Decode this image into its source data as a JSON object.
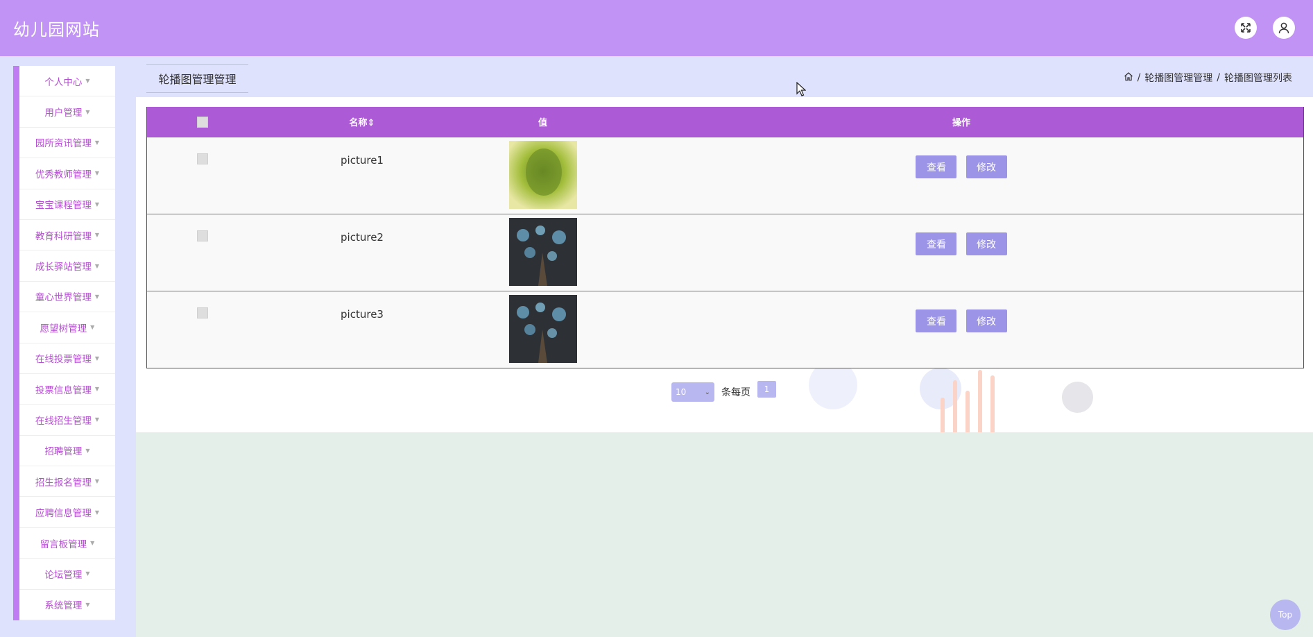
{
  "app": {
    "title": "幼儿园网站"
  },
  "sidebar": {
    "items": [
      {
        "label": "个人中心"
      },
      {
        "label": "用户管理"
      },
      {
        "label": "园所资讯管理"
      },
      {
        "label": "优秀教师管理"
      },
      {
        "label": "宝宝课程管理"
      },
      {
        "label": "教育科研管理"
      },
      {
        "label": "成长驿站管理"
      },
      {
        "label": "童心世界管理"
      },
      {
        "label": "愿望树管理"
      },
      {
        "label": "在线投票管理"
      },
      {
        "label": "投票信息管理"
      },
      {
        "label": "在线招生管理"
      },
      {
        "label": "招聘管理"
      },
      {
        "label": "招生报名管理"
      },
      {
        "label": "应聘信息管理"
      },
      {
        "label": "留言板管理"
      },
      {
        "label": "论坛管理"
      },
      {
        "label": "系统管理"
      }
    ]
  },
  "page": {
    "tab_label": "轮播图管理管理"
  },
  "breadcrumb": {
    "sep": "/",
    "level1": "轮播图管理管理",
    "level2": "轮播图管理列表"
  },
  "table": {
    "headers": {
      "name": "名称",
      "value": "值",
      "ops": "操作"
    },
    "rows": [
      {
        "name": "picture1",
        "view": "查看",
        "edit": "修改"
      },
      {
        "name": "picture2",
        "view": "查看",
        "edit": "修改"
      },
      {
        "name": "picture3",
        "view": "查看",
        "edit": "修改"
      }
    ]
  },
  "pagination": {
    "page_size": "10",
    "per_page_label": "条每页",
    "current_page": "1"
  },
  "back_to_top": "Top",
  "colors": {
    "header": "#c193f5",
    "table_header": "#ad5ad7",
    "sidebar_text": "#b64ed3",
    "button": "#9c95e7"
  }
}
